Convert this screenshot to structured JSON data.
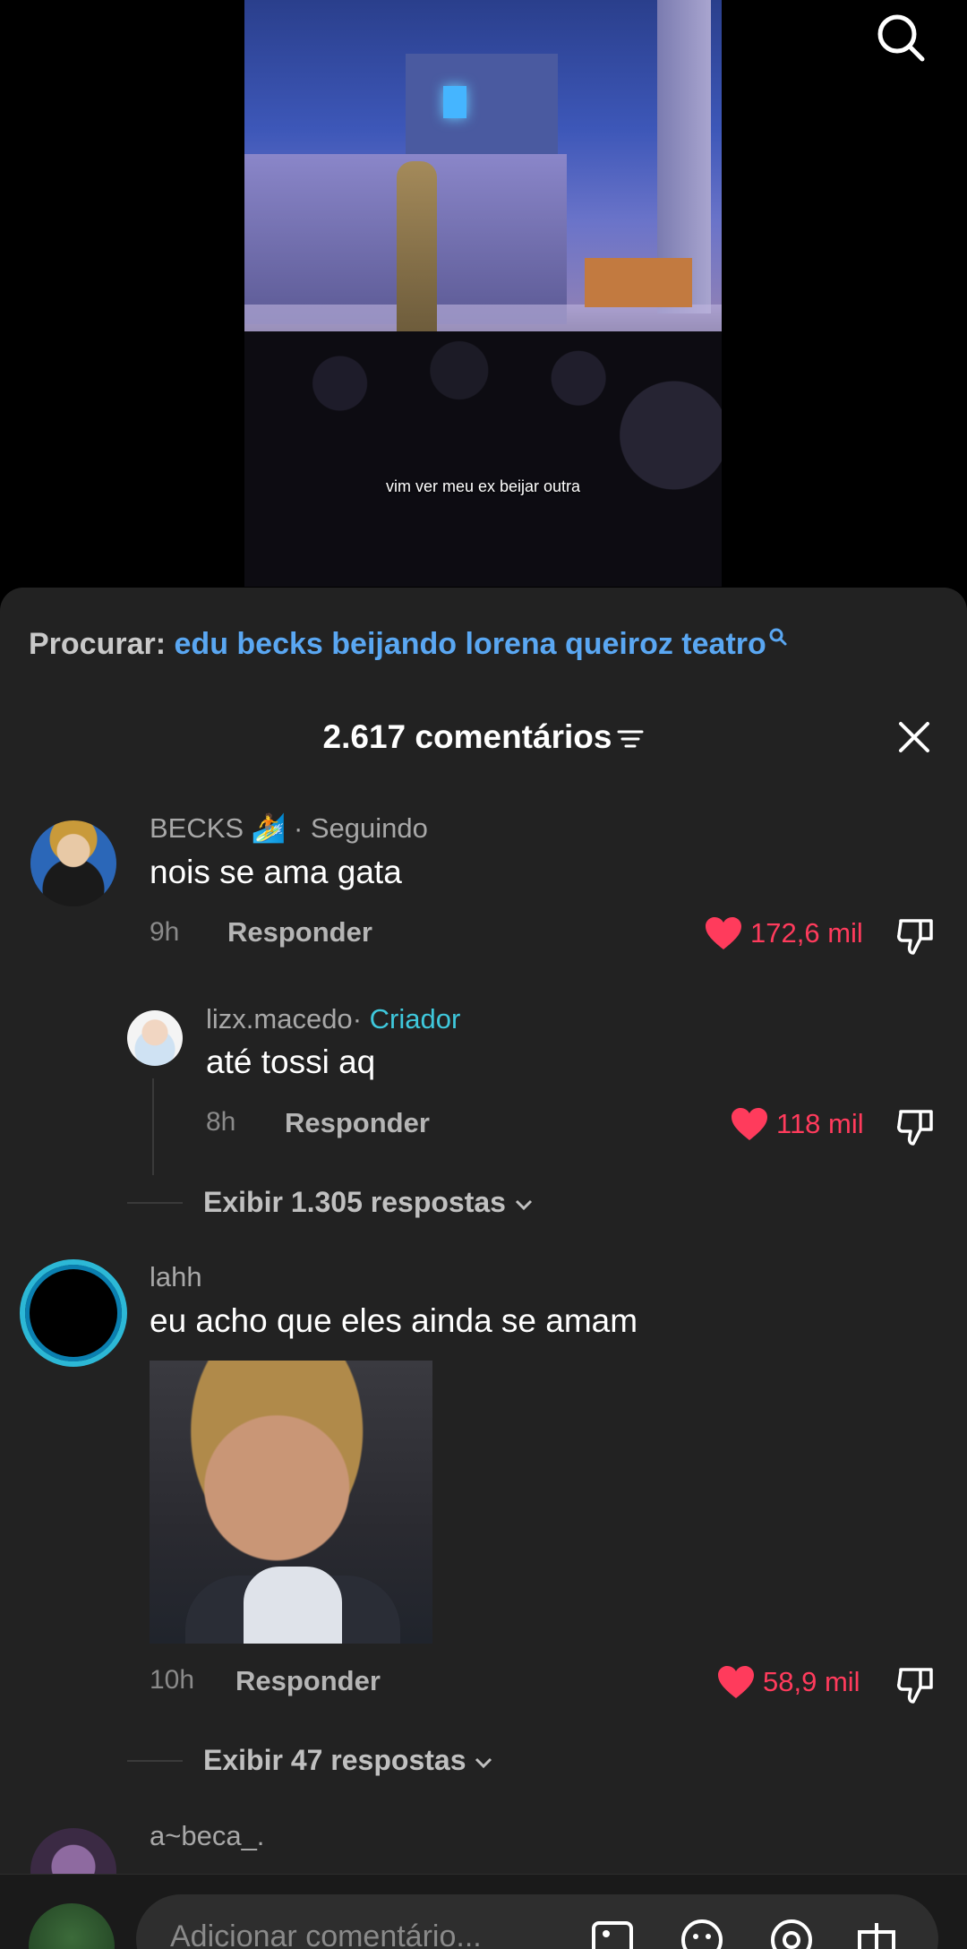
{
  "video": {
    "caption": "vim ver meu ex beijar outra"
  },
  "search_bar": {
    "prefix": "Procurar:",
    "query": "edu becks beijando lorena queiroz teatro"
  },
  "comments_header": {
    "count_label": "2.617 comentários"
  },
  "comments": [
    {
      "user": "BECKS 🏄",
      "tag": "· Seguindo",
      "text": "nois se ama gata",
      "time": "9h",
      "reply": "Responder",
      "likes": "172,6 mil"
    },
    {
      "user": "lizx.macedo",
      "tag": "· ",
      "creator": "Criador",
      "text": "até tossi aq",
      "time": "8h",
      "reply": "Responder",
      "likes": "118 mil"
    },
    {
      "user": "lahh",
      "text": "eu acho que eles ainda se amam",
      "time": "10h",
      "reply": "Responder",
      "likes": "58,9 mil"
    },
    {
      "user": "a~beca_."
    }
  ],
  "view_replies": [
    "Exibir 1.305 respostas",
    "Exibir 47 respostas"
  ],
  "input": {
    "placeholder": "Adicionar comentário..."
  },
  "colors": {
    "like": "#ff3b5c",
    "link": "#5aa7f2",
    "creator": "#3fc8dc",
    "sheet": "#222222"
  }
}
